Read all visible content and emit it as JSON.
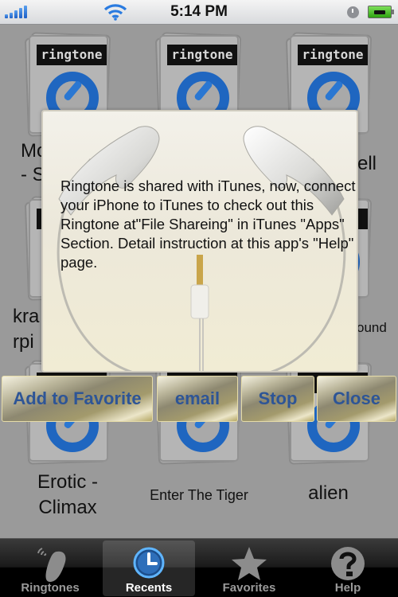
{
  "status_bar": {
    "time": "5:14 PM",
    "signal_bars": 5,
    "wifi": "wifi-icon",
    "alarm": "clock-icon",
    "battery": "charging"
  },
  "grid": {
    "band_label": "ringtone",
    "tiles": [
      {
        "name": "Mo\n- S"
      },
      {
        "name": ""
      },
      {
        "name": "ell"
      },
      {
        "name": "kra\nrpi"
      },
      {
        "name": ""
      },
      {
        "name": "ound"
      },
      {
        "name": "Erotic -\nClimax"
      },
      {
        "name": "Enter The Tiger"
      },
      {
        "name": "alien"
      }
    ]
  },
  "popup": {
    "message": "Ringtone is shared with iTunes, now, connect your iPhone to iTunes to check out this Ringtone at\"File Shareing\" in iTunes \"Apps\" Section. Detail instruction at this app's \"Help\" page."
  },
  "actions": {
    "add_favorite": "Add to Favorite",
    "email": "email",
    "stop": "Stop",
    "close": "Close"
  },
  "tabbar": {
    "tabs": [
      {
        "label": "Ringtones",
        "icon": "ringtone-phone-icon",
        "active": false
      },
      {
        "label": "Recents",
        "icon": "clock-icon",
        "active": true
      },
      {
        "label": "Favorites",
        "icon": "star-icon",
        "active": false
      },
      {
        "label": "Help",
        "icon": "help-icon",
        "active": false
      }
    ]
  }
}
